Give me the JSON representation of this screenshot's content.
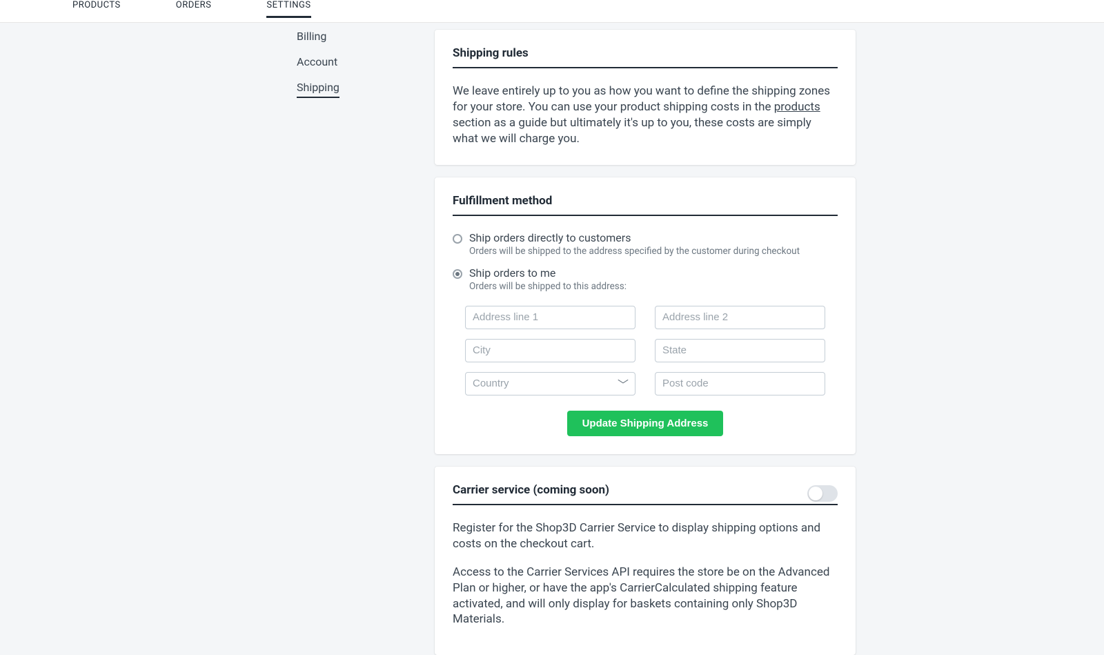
{
  "nav": {
    "products": "PRODUCTS",
    "orders": "ORDERS",
    "settings": "SETTINGS"
  },
  "side": {
    "billing": "Billing",
    "account": "Account",
    "shipping": "Shipping"
  },
  "shipping_rules": {
    "title": "Shipping rules",
    "desc_a": "We leave entirely up to you as how you want to define the shipping zones for your store. You can use your product shipping costs in the ",
    "link": "products",
    "desc_b": " section as a guide but ultimately it's up to you, these costs are simply what we will charge you."
  },
  "fulfillment": {
    "title": "Fulfillment method",
    "opt1_label": "Ship orders directly to customers",
    "opt1_sub": "Orders will be shipped to the address specified by the customer during checkout",
    "opt2_label": "Ship orders to me",
    "opt2_sub": "Orders will be shipped to this address:",
    "placeholders": {
      "addr1": "Address line 1",
      "addr2": "Address line 2",
      "city": "City",
      "state": "State",
      "country": "Country",
      "post": "Post code"
    },
    "button": "Update Shipping Address"
  },
  "carrier": {
    "title": "Carrier service (coming soon)",
    "p1": "Register for the Shop3D Carrier Service to display shipping options and costs on the checkout cart.",
    "p2": "Access to the Carrier Services API requires the store be on the Advanced Plan or higher, or have the app's CarrierCalculated shipping feature activated, and will only display for baskets containing only Shop3D Materials."
  }
}
